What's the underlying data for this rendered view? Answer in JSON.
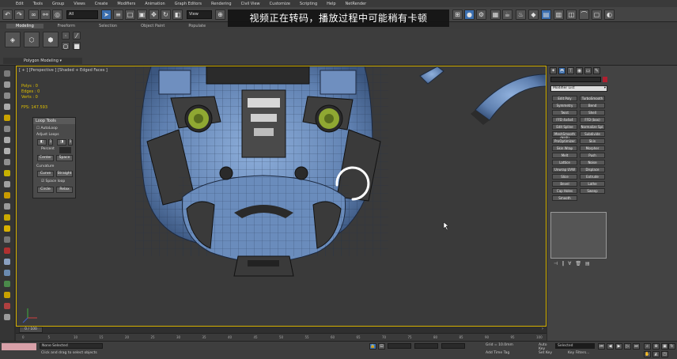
{
  "banner": {
    "text": "视频正在转码，播放过程中可能稍有卡顿"
  },
  "menu": [
    "Edit",
    "Tools",
    "Group",
    "Views",
    "Create",
    "Modifiers",
    "Animation",
    "Graph Editors",
    "Rendering",
    "Civil View",
    "Customize",
    "Scripting",
    "Help",
    "NetRender"
  ],
  "toolbar": {
    "selection_filter": "All",
    "view_dropdown": "View"
  },
  "ribbon": {
    "tabs": [
      "Modeling",
      "Freeform",
      "Selection",
      "Object Paint",
      "Populate"
    ],
    "active_tab": "Modeling",
    "panel_label": "Polygon Modeling ▾"
  },
  "viewport": {
    "label": "[ + ] [Perspective ] [Shaded + Edged Faces ]",
    "stats": [
      {
        "name": "Polys :",
        "value": "0"
      },
      {
        "name": "Edges :",
        "value": "0"
      },
      {
        "name": "Verts :",
        "value": "0"
      }
    ],
    "fps": "FPS:   147.593"
  },
  "looptools": {
    "title": "Loop Tools",
    "autoloop": "AutoLoop",
    "adjust_loops": "Adjust Loops",
    "percent_label": "Percent",
    "center": "Center",
    "space": "Space",
    "curvature": "Curvature",
    "curve": "Curve",
    "straight": "Straight",
    "space_loop": "Space loop",
    "circle": "Circle",
    "relax": "Relax"
  },
  "command_panel": {
    "modifier_list": "Modifier List",
    "buttons": [
      [
        "Edit Poly",
        "TurboSmooth"
      ],
      [
        "Symmetry",
        "Bend"
      ],
      [
        "Twist",
        "Shell"
      ],
      [
        "FFD 4x4x4",
        "FFD (box)"
      ],
      [
        "Edit Spline",
        "Normalize Spl."
      ],
      [
        "MeshSmooth (NUR)",
        "Subdivide"
      ],
      [
        "ProOptimizer",
        "Skin"
      ],
      [
        "Skin Wrap",
        "Morpher"
      ],
      [
        "Melt",
        "Push"
      ],
      [
        "Lattice",
        "Noise"
      ],
      [
        "Unwrap UVW",
        "Displace"
      ],
      [
        "Slice",
        "Extrude"
      ],
      [
        "Bevel",
        "Lathe"
      ],
      [
        "Cap Holes",
        "Sweep"
      ],
      [
        "Smooth",
        ""
      ]
    ]
  },
  "timeline": {
    "frame": "0 / 100",
    "ticks": [
      "0",
      "5",
      "10",
      "15",
      "20",
      "25",
      "30",
      "35",
      "40",
      "45",
      "50",
      "55",
      "60",
      "65",
      "70",
      "75",
      "80",
      "85",
      "90",
      "95",
      "100"
    ]
  },
  "status": {
    "selection": "None Selected",
    "prompt": "Click and drag to select objects",
    "grid": "Grid = 10.0mm",
    "auto_key": "Auto Key",
    "set_key": "Set Key",
    "selected": "Selected",
    "key_filters": "Key Filters...",
    "add_time_tag": "Add Time Tag"
  },
  "colors": {
    "accent": "#3b6fb0",
    "viewport_border": "#d4b000",
    "stat_text": "#e0c000",
    "model_blue": "#6f8fbf",
    "eye_green": "#8fa832"
  }
}
